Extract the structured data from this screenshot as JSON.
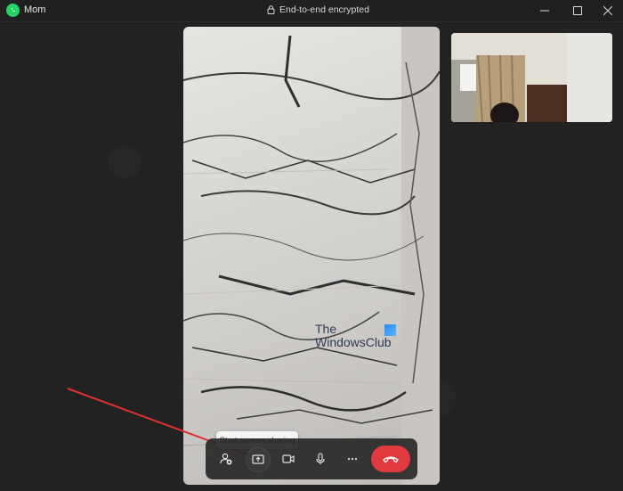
{
  "window": {
    "title": "Mom",
    "status": "End-to-end encrypted"
  },
  "video": {
    "watermark_line1": "The",
    "watermark_line2": "WindowsClub"
  },
  "controls": {
    "tooltip": "Start screen sharing"
  },
  "colors": {
    "end_call": "#e0393e",
    "app_icon": "#25d366",
    "annotation_arrow": "#e03030"
  }
}
